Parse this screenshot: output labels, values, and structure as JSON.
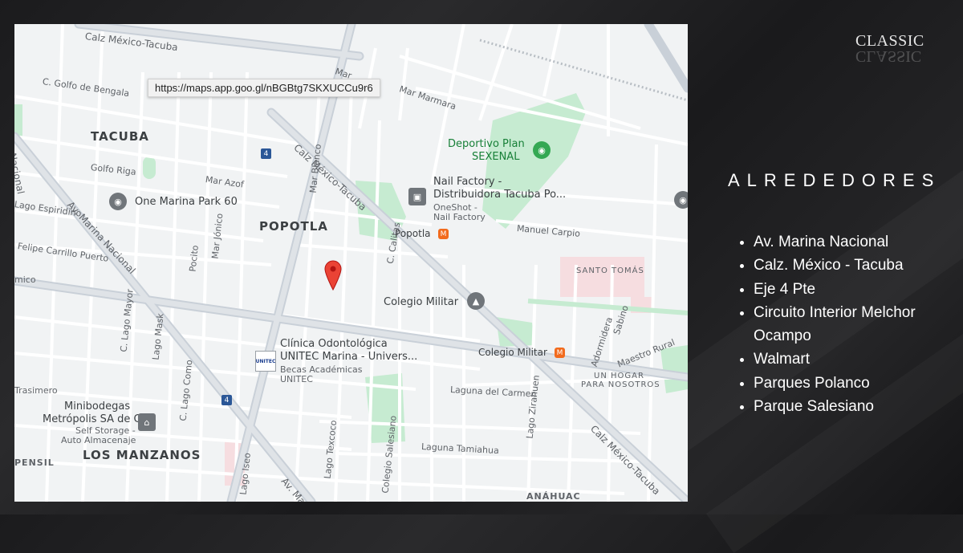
{
  "brand": {
    "logo_text": "CLASSIC"
  },
  "tooltip": {
    "url": "https://maps.app.goo.gl/nBGBtg7SKXUCCu9r6"
  },
  "section": {
    "heading": "ALREDEDORES",
    "places": [
      "Av. Marina Nacional",
      "Calz. México - Tacuba",
      "Eje 4 Pte",
      "Circuito Interior Melchor Ocampo",
      "Walmart",
      "Parques Polanco",
      "Parque Salesiano"
    ]
  },
  "map": {
    "areas": [
      "TACUBA",
      "POPOTLA",
      "LOS MANZANOS"
    ],
    "roads": {
      "calz_top": "Calz México-Tacuba",
      "calz_mid": "Calz México-Tacuba",
      "calz_bottom": "Calz México-Tacuba",
      "marina_v": "Marina Nacional",
      "marina_d": "Av. Marina Nacional",
      "marina_bottom": "Av. Ma",
      "golfo_bengala": "C. Golfo de Bengala",
      "golfo_riga": "Golfo Riga",
      "mar_azof": "Mar Azof",
      "espiridino": "Lago Espiridino",
      "felipe": "Felipe Carrillo Puerto",
      "mar_blanco": "Mar Blanco",
      "mar_jonico": "Mar Jónico",
      "pocito": "Pocito",
      "lago_mayor": "C. Lago Mayor",
      "lago_mask": "Lago Mask",
      "lago_como": "C. Lago Como",
      "lago_texcoco": "Lago Texcoco",
      "lago_iseo": "Lago Iseo",
      "colegio_salesiano": "Colegio Salesiano",
      "laguna_carmen": "Laguna del Carmen",
      "laguna_tamiahua": "Laguna Tamiahua",
      "lago_zirahuen": "Lago Zirahuen",
      "manuel_carpio": "Manuel Carpio",
      "mar_marmara": "Mar Marmara",
      "mar_top": "Mar",
      "c_calitas": "C. Calitas",
      "maestro_rural": "Maestro Rural",
      "adormidera": "Adormidera",
      "sabino": "Sabino",
      "trasimero": "Trasimero",
      "pensil": "PENSIL",
      "mico": "mico",
      "anahuac": "ANÁHUAC"
    },
    "shields": [
      "4",
      "4"
    ],
    "pois": {
      "one_marina": "One Marina Park 60",
      "deportivo_1": "Deportivo Plan",
      "deportivo_2": "SEXENAL",
      "nail_1": "Nail Factory -",
      "nail_2": "Distribuidora Tacuba Po...",
      "nail_sub_1": "OneShot -",
      "nail_sub_2": "Nail Factory",
      "popotla_metro": "Popotla",
      "colegio_militar": "Colegio Militar",
      "colegio_militar_metro": "Colegio Militar",
      "clinica_1": "Clínica Odontológica",
      "clinica_2": "UNITEC Marina - Univers...",
      "clinica_sub_1": "Becas Académicas",
      "clinica_sub_2": "UNITEC",
      "unitec_logo": "UNITEC",
      "mini_1": "Minibodegas",
      "mini_2": "Metrópolis SA de CV",
      "mini_sub_1": "Self Storage -",
      "mini_sub_2": "Auto Almacenaje",
      "santo_tomas": "SANTO TOMÁS",
      "un_hogar_1": "UN HOGAR",
      "un_hogar_2": "PARA NOSOTROS"
    },
    "colors": {
      "land": "#f1f3f4",
      "road": "#ffffff",
      "highway": "#c9d0d8",
      "park": "#c6ebd1",
      "pin": "#ea4335"
    }
  }
}
